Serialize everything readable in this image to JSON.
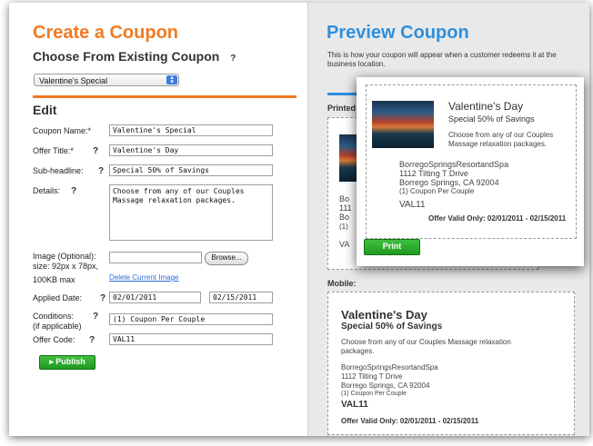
{
  "create": {
    "title": "Create a Coupon",
    "choose_label": "Choose From Existing Coupon",
    "selected_coupon": "Valentine's Special",
    "edit_label": "Edit",
    "help_mark": "?",
    "fields": {
      "coupon_name_label": "Coupon Name:*",
      "coupon_name_value": "Valentine's Special",
      "offer_title_label": "Offer Title:*",
      "offer_title_value": "Valentine's Day",
      "subheadline_label": "Sub-headline:",
      "subheadline_value": "Special 50% of Savings",
      "details_label": "Details:",
      "details_value": "Choose from any of our Couples Massage relaxation packages.",
      "image_label_1": "Image (Optional):",
      "image_label_2": "size: 92px x 78px,",
      "image_label_3": "100KB max",
      "browse_label": "Browse...",
      "delete_image_link": "Delete Current Image",
      "applied_date_label": "Applied Date:",
      "date_start": "02/01/2011",
      "date_end": "02/15/2011",
      "conditions_label_1": "Conditions:",
      "conditions_label_2": "(if applicable)",
      "conditions_value": "(1) Coupon Per Couple",
      "offer_code_label": "Offer Code:",
      "offer_code_value": "VAL11"
    },
    "publish_label": "▸ Publish"
  },
  "preview": {
    "title": "Preview Coupon",
    "description": "This is how your coupon will appear when a customer redeems it at the business location.",
    "printed_label": "Printed:",
    "mobile_label": "Mobile:",
    "coupon": {
      "title": "Valentine's Day",
      "subtitle": "Special 50% of Savings",
      "details": "Choose from any of our Couples Massage relaxation packages.",
      "business": "BorregoSpringsResortandSpa",
      "address1": "1112 Tilting T Drive",
      "address2": "Borrego Springs, CA 92004",
      "condition": "(1) Coupon Per Couple",
      "code": "VAL11",
      "valid": "Offer Valid Only: 02/01/2011 - 02/15/2011"
    },
    "printed_fragments": {
      "line1": "Bo",
      "line2": "111",
      "line3": "Bo",
      "line4": "(1)",
      "line5": "VA"
    },
    "print_label": "Print"
  }
}
